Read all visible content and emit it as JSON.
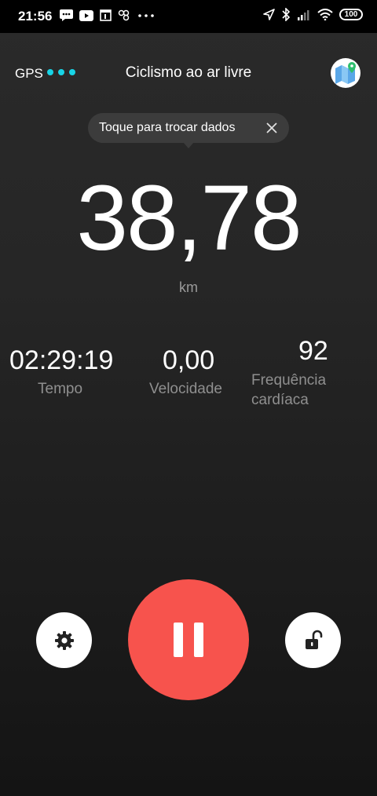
{
  "status_bar": {
    "time": "21:56",
    "battery": "100"
  },
  "header": {
    "gps_label": "GPS",
    "title": "Ciclismo ao ar livre"
  },
  "tooltip": {
    "text": "Toque para trocar dados"
  },
  "main_metric": {
    "value": "38,78",
    "unit": "km"
  },
  "metrics": [
    {
      "value": "02:29:19",
      "label": "Tempo"
    },
    {
      "value": "0,00",
      "label": "Velocidade"
    },
    {
      "value": "92",
      "label_line1": "Frequência",
      "label_line2": "cardíaca"
    }
  ],
  "icons": {
    "settings": "gear-icon",
    "pause": "pause-icon",
    "lock": "unlock-icon",
    "map": "map-icon"
  },
  "colors": {
    "accent_dots": "#18d4e6",
    "pause_button": "#f7534d"
  }
}
